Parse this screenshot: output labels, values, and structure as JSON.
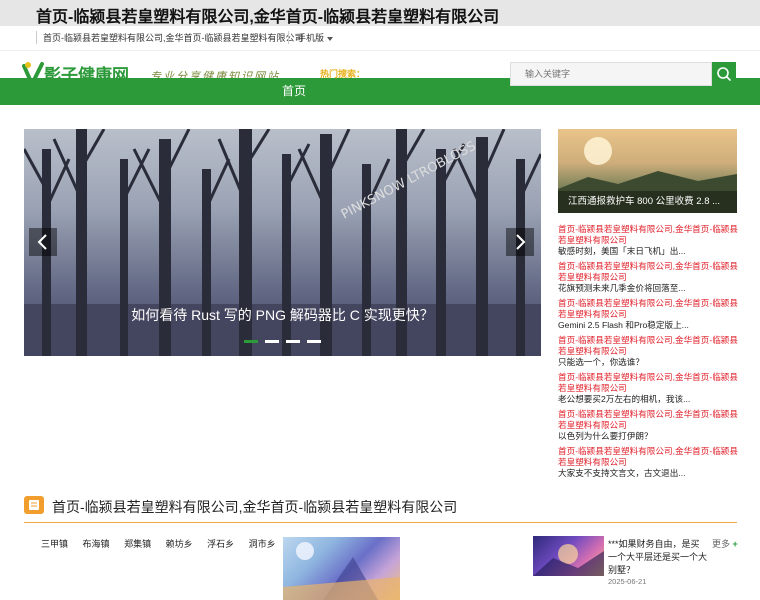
{
  "page": {
    "title": "首页-临颍县若皇塑料有限公司,金华首页-临颍县若皇塑料有限公司"
  },
  "topbar": {
    "breadcrumb": "首页-临颍县若皇塑料有限公司,金华首页-临颍县若皇塑料有限公司",
    "mobile_label": "手机版"
  },
  "header": {
    "logo_text": "影子健康网",
    "slogan": "专业分享健康知识网站",
    "hot_search_label": "热门搜索：",
    "search_placeholder": "输入关键字",
    "search_icon": "search-icon"
  },
  "nav": {
    "items": [
      {
        "label": "首页"
      }
    ]
  },
  "slider": {
    "caption": "如何看待 Rust 写的 PNG 解码器比 C 实现更快？",
    "slide_count": 4,
    "active_index": 0
  },
  "side_feature": {
    "caption": "江西通报救护车 800 公里收费 2.8 ..."
  },
  "news": [
    {
      "title": "首页-临颍县若皇塑料有限公司,金华首页-临颍县若皇塑料有限公司",
      "desc": "敏感时刻，美国「末日飞机」出..."
    },
    {
      "title": "首页-临颍县若皇塑料有限公司,金华首页-临颍县若皇塑料有限公司",
      "desc": "花旗预测未来几季金价将回落至..."
    },
    {
      "title": "首页-临颍县若皇塑料有限公司,金华首页-临颍县若皇塑料有限公司",
      "desc": "Gemini 2.5 Flash 和Pro稳定版上..."
    },
    {
      "title": "首页-临颍县若皇塑料有限公司,金华首页-临颍县若皇塑料有限公司",
      "desc": "只能选一个，你选谁？"
    },
    {
      "title": "首页-临颍县若皇塑料有限公司,金华首页-临颍县若皇塑料有限公司",
      "desc": "老公想要买2万左右的相机，我该..."
    },
    {
      "title": "首页-临颍县若皇塑料有限公司,金华首页-临颍县若皇塑料有限公司",
      "desc": "以色列为什么要打伊朗？"
    },
    {
      "title": "首页-临颍县若皇塑料有限公司,金华首页-临颍县若皇塑料有限公司",
      "desc": "大家支不支持文言文，古文退出..."
    }
  ],
  "section": {
    "title": "首页-临颍县若皇塑料有限公司,金华首页-临颍县若皇塑料有限公司",
    "icon": "note-icon",
    "tags": [
      "三甲镇",
      "布海镇",
      "郑集镇",
      "赖坊乡",
      "浮石乡",
      "洞市乡"
    ],
    "more_label": "更多",
    "article_title": "***如果财务自由，是买一个大平层还是买一个大别墅？",
    "article_date": "2025-06-21"
  },
  "colors": {
    "brand_green": "#2d9a3a",
    "accent_orange": "#f29e2e",
    "link_red": "#e0212b"
  }
}
